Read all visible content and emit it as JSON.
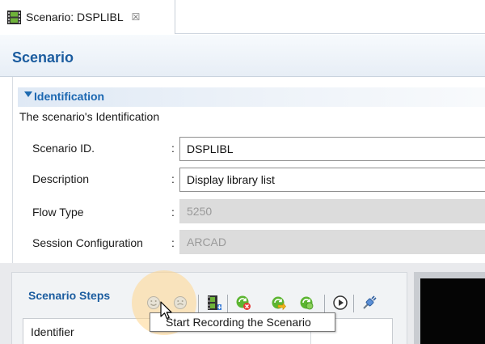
{
  "editor_tab": {
    "title": "Scenario: DSPLIBL",
    "close_glyph": "☒",
    "icon": "film-icon"
  },
  "form": {
    "title": "Scenario"
  },
  "identification": {
    "title": "Identification",
    "description": "The scenario's Identification",
    "fields": [
      {
        "label": "Scenario ID.",
        "colon": ":",
        "value": "DSPLIBL",
        "enabled": true
      },
      {
        "label": "Description",
        "colon": ":",
        "value": "Display library list",
        "enabled": true
      },
      {
        "label": "Flow Type",
        "colon": ":",
        "value": "5250",
        "enabled": false
      },
      {
        "label": "Session Configuration",
        "colon": ":",
        "value": "ARCAD",
        "enabled": false
      }
    ]
  },
  "steps": {
    "title": "Scenario Steps",
    "columns": [
      "Identifier"
    ],
    "toolbar": [
      {
        "name": "start-recording-button",
        "icon": "record-icon"
      },
      {
        "name": "stop-recording-button",
        "icon": "stop-record-icon"
      },
      {
        "name": "add-film-button",
        "icon": "film-add-icon"
      },
      {
        "name": "delete-step-button",
        "icon": "delete-icon"
      },
      {
        "name": "insert-step-button",
        "icon": "insert-icon"
      },
      {
        "name": "refresh-step-button",
        "icon": "refresh-icon"
      },
      {
        "name": "play-button",
        "icon": "play-icon"
      },
      {
        "name": "connect-button",
        "icon": "plug-icon"
      }
    ]
  },
  "tooltip": {
    "text": "Start Recording the Scenario"
  },
  "colors": {
    "header_title": "#1b5c9f",
    "section_title": "#1b67b1",
    "tooltip_border": "#767676",
    "disabled_field": "#dcdcdc",
    "hover_highlight": "#ffd68c"
  }
}
